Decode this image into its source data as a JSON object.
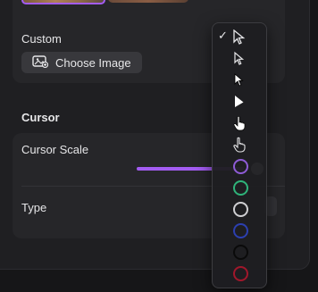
{
  "background": {
    "custom_label": "Custom",
    "choose_image_label": "Choose Image"
  },
  "cursor": {
    "section_title": "Cursor",
    "scale_label": "Cursor Scale",
    "scale_value": 0.88,
    "type_label": "Type"
  },
  "cursor_menu": {
    "selected_index": 0,
    "options": [
      {
        "name": "arrow-outline"
      },
      {
        "name": "arrow-outline-small"
      },
      {
        "name": "arrow-filled"
      },
      {
        "name": "arrow-filled-large"
      },
      {
        "name": "hand-pointer"
      },
      {
        "name": "hand-pointer-outline"
      },
      {
        "name": "circle",
        "color": "#8e5bd6"
      },
      {
        "name": "circle",
        "color": "#2fb37a"
      },
      {
        "name": "circle",
        "color": "#cfcfd2"
      },
      {
        "name": "circle",
        "color": "#2c3fb0"
      },
      {
        "name": "circle",
        "color": "#0a0a0a"
      },
      {
        "name": "circle",
        "color": "#a0172b"
      }
    ]
  },
  "colors": {
    "accent": "#a35cf2"
  }
}
